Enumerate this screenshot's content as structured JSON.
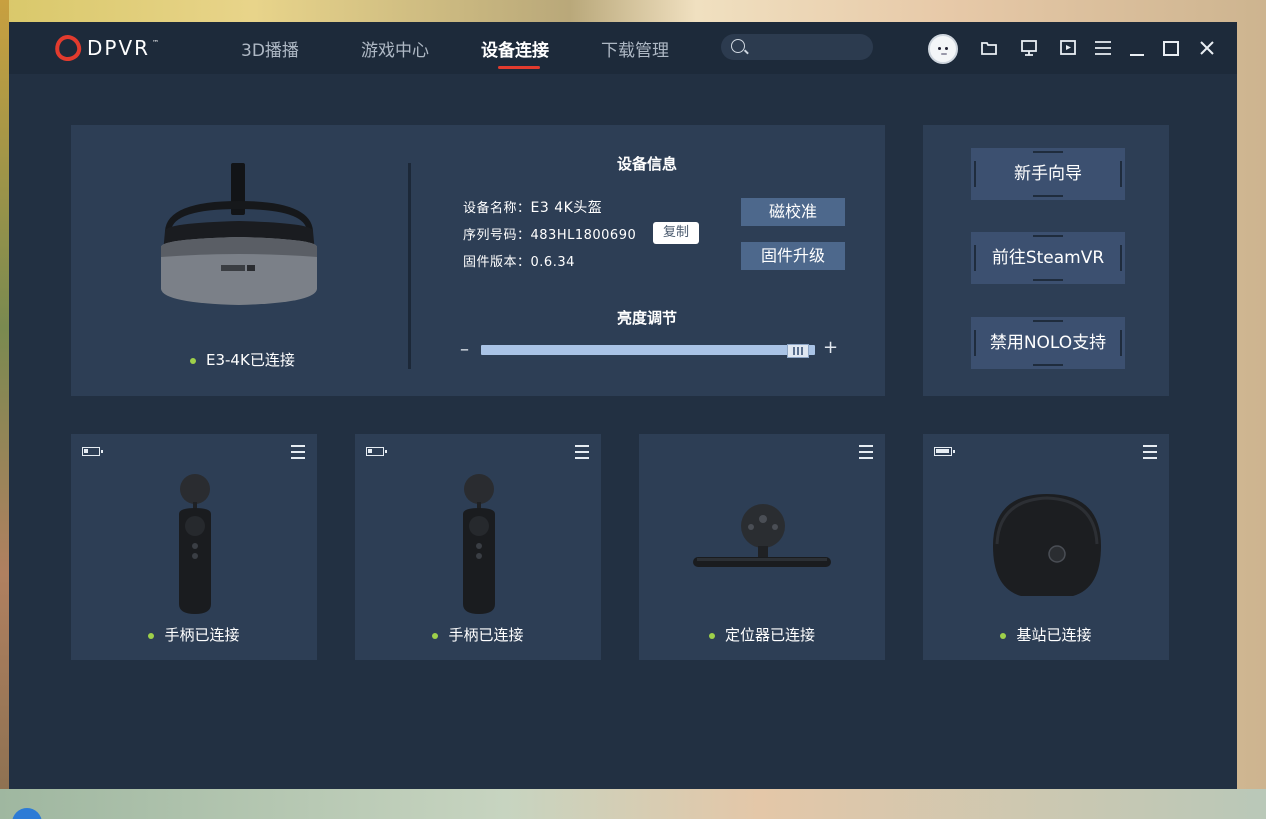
{
  "app": {
    "brand": "DPVR",
    "brand_tm": "™"
  },
  "nav": {
    "items": [
      {
        "label": "3D播播"
      },
      {
        "label": "游戏中心"
      },
      {
        "label": "设备连接",
        "active": true
      },
      {
        "label": "下载管理"
      }
    ]
  },
  "search": {
    "placeholder": "",
    "value": ""
  },
  "toolbar": {
    "icons": [
      "avatar",
      "folder-icon",
      "monitor-icon",
      "play-icon",
      "menu-icon",
      "minimize-icon",
      "maximize-icon",
      "close-icon"
    ]
  },
  "headset": {
    "status": "E3-4K已连接",
    "status_color": "#9ed04a"
  },
  "device_info": {
    "title": "设备信息",
    "name_label": "设备名称：",
    "name_value": "E3 4K头盔",
    "serial_label": "序列号码：",
    "serial_value": "483HL1800690",
    "firmware_label": "固件版本：",
    "firmware_value": "0.6.34",
    "copy_label": "复制",
    "calibrate_label": "磁校准",
    "upgrade_label": "固件升级"
  },
  "brightness": {
    "title": "亮度调节",
    "minus": "–",
    "plus": "+",
    "level": 0.98
  },
  "side": {
    "guide_label": "新手向导",
    "steamvr_label": "前往SteamVR",
    "nolo_label": "禁用NOLO支持"
  },
  "devices": [
    {
      "kind": "controller",
      "status": "手柄已连接",
      "battery": 0.3
    },
    {
      "kind": "controller",
      "status": "手柄已连接",
      "battery": 0.3
    },
    {
      "kind": "tracker",
      "status": "定位器已连接",
      "battery": null
    },
    {
      "kind": "base-station",
      "status": "基站已连接",
      "battery": 1.0
    }
  ],
  "colors": {
    "accent": "#e23b2e",
    "panel": "#2d3e55",
    "window": "#223042",
    "button": "#4d688c"
  }
}
